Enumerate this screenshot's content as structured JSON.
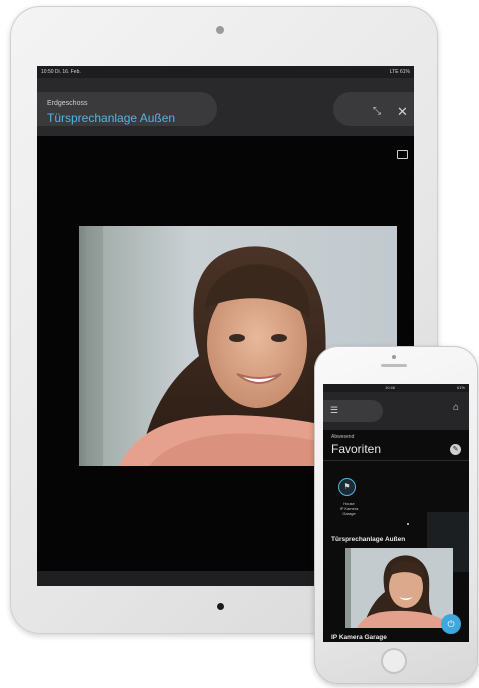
{
  "tablet": {
    "status": {
      "left": "10:50 Di. 16. Feb.",
      "right": "LTE 61%"
    },
    "header": {
      "subtitle": "Erdgeschoss",
      "title": "Türsprechanlage Außen"
    },
    "icons": {
      "resize": "resize-icon",
      "close": "close-icon",
      "window": "window-icon"
    },
    "accent_color": "#52b4e4"
  },
  "phone": {
    "status": {
      "left": "",
      "center": "10:46",
      "right": "61%"
    },
    "header": {
      "menu_icon": "menu-icon",
      "home_icon": "home-icon"
    },
    "section_subtitle": "Abwesend",
    "section_title": "Favoriten",
    "favorite": {
      "line1": "House",
      "line2": "IP Kamera",
      "line3": "Garage"
    },
    "camera1": "Türsprechanlage Außen",
    "camera2": "IP Kamera Garage",
    "fab_icon": "door-open-icon",
    "accent_color": "#3fa7de"
  }
}
